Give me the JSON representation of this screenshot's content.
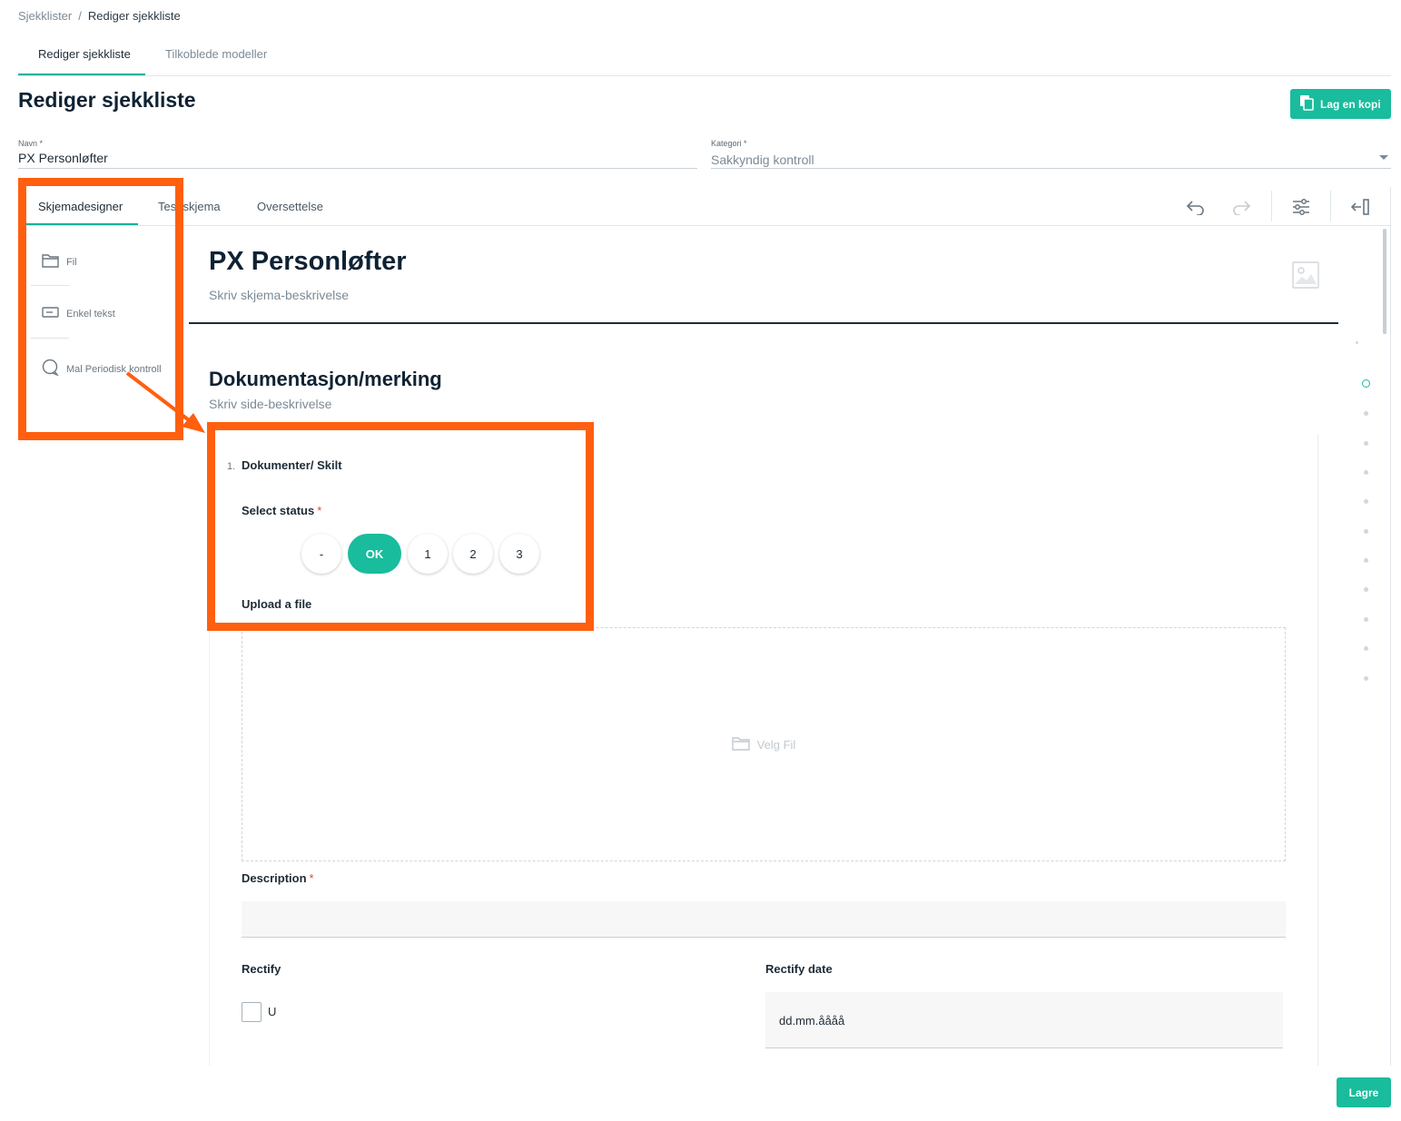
{
  "breadcrumb": {
    "root": "Sjekklister",
    "separator": "/",
    "current": "Rediger sjekkliste"
  },
  "top_tabs": [
    {
      "label": "Rediger sjekkliste",
      "active": true
    },
    {
      "label": "Tilkoblede modeller",
      "active": false
    }
  ],
  "page": {
    "title": "Rediger sjekkliste",
    "copy_button": "Lag en kopi",
    "save_button": "Lagre"
  },
  "form": {
    "name_label": "Navn",
    "name_required": "*",
    "name_value": "PX Personløfter",
    "category_label": "Kategori",
    "category_required": "*",
    "category_value": "Sakkyndig kontroll"
  },
  "designer_tabs": [
    {
      "label": "Skjemadesigner",
      "active": true
    },
    {
      "label": "Test skjema",
      "active": false
    },
    {
      "label": "Oversettelse",
      "active": false
    }
  ],
  "toolbar": {
    "undo_icon": "undo-icon",
    "redo_icon": "redo-icon",
    "settings_icon": "sliders-icon",
    "collapse_icon": "collapse-panel-icon"
  },
  "toolbox": [
    {
      "label": "Fil",
      "icon": "folder-icon"
    },
    {
      "label": "Enkel tekst",
      "icon": "text-field-icon"
    },
    {
      "label": "Mal Periodisk kontroll",
      "icon": "speech-bubble-icon"
    }
  ],
  "survey": {
    "title": "PX Personløfter",
    "description_placeholder": "Skriv skjema-beskrivelse",
    "page_title": "Dokumentasjon/merking",
    "page_description_placeholder": "Skriv side-beskrivelse"
  },
  "question": {
    "number": "1.",
    "title": "Dokumenter/ Skilt",
    "status_label": "Select status",
    "required_mark": "*",
    "status_options": [
      "-",
      "OK",
      "1",
      "2",
      "3"
    ],
    "status_selected": "OK",
    "upload_label": "Upload a file",
    "upload_button": "Velg Fil",
    "description_label": "Description",
    "rectify_label": "Rectify",
    "rectify_checkbox_label": "U",
    "rectify_date_label": "Rectify date",
    "rectify_date_placeholder": "dd.mm.åååå"
  },
  "colors": {
    "accent": "#19bc9c",
    "annotation": "#ff5f0f",
    "text_dark": "#0f2233",
    "muted": "#7c8a96"
  }
}
